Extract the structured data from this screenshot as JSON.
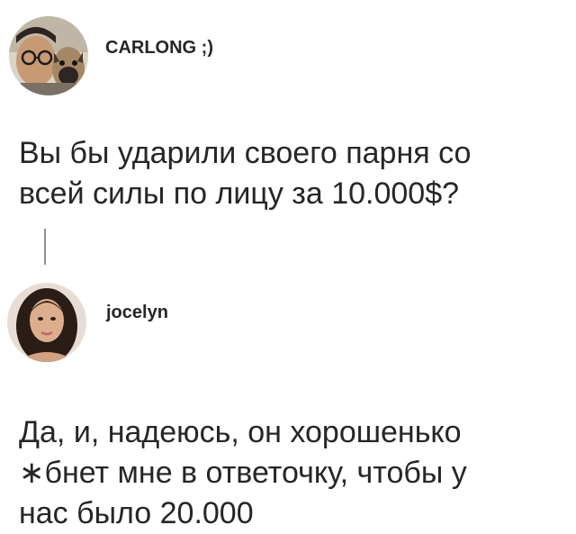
{
  "posts": [
    {
      "username": "CARLONG ;)",
      "avatar_icon": "user-with-dog-avatar",
      "text_line_1": "Вы бы ударили своего парня со",
      "text_line_2": "всей силы по лицу за 10.000$?"
    },
    {
      "username": "jocelyn",
      "avatar_icon": "user-avatar",
      "text_line_1": "Да, и, надеюсь, он хорошенько",
      "text_line_2": "∗бнет мне в ответочку, чтобы у",
      "text_line_3": "нас было 20.000"
    }
  ],
  "colors": {
    "text": "#262626",
    "thread_line": "#8f8f8f",
    "background": "#ffffff"
  }
}
